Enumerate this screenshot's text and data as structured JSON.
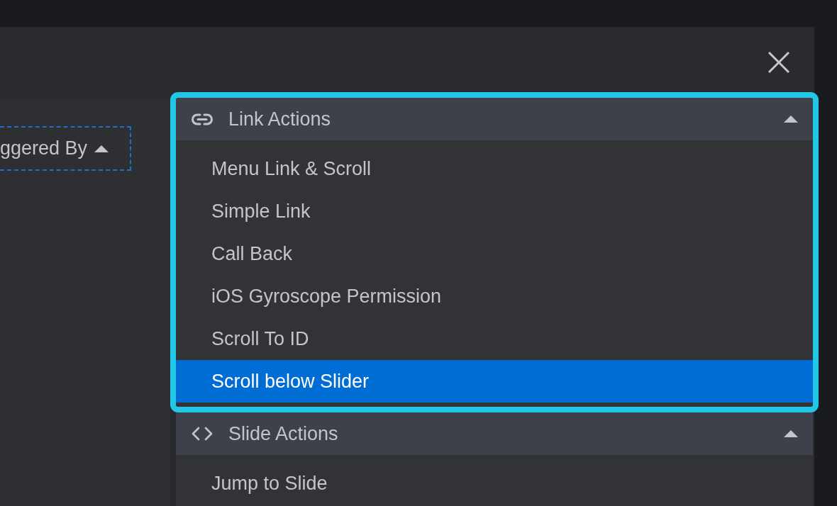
{
  "dialog": {
    "trigger_button": {
      "label": "ggered By",
      "expanded": true
    },
    "action_groups": [
      {
        "kind": "link",
        "label": "Link Actions",
        "expanded": true,
        "highlighted": true,
        "items": [
          {
            "label": "Menu Link & Scroll",
            "selected": false
          },
          {
            "label": "Simple Link",
            "selected": false
          },
          {
            "label": "Call Back",
            "selected": false
          },
          {
            "label": "iOS Gyroscope Permission",
            "selected": false
          },
          {
            "label": "Scroll To ID",
            "selected": false
          },
          {
            "label": "Scroll below Slider",
            "selected": true
          }
        ]
      },
      {
        "kind": "slide",
        "label": "Slide Actions",
        "expanded": true,
        "highlighted": false,
        "items": [
          {
            "label": "Jump to Slide",
            "selected": false
          }
        ]
      }
    ]
  }
}
